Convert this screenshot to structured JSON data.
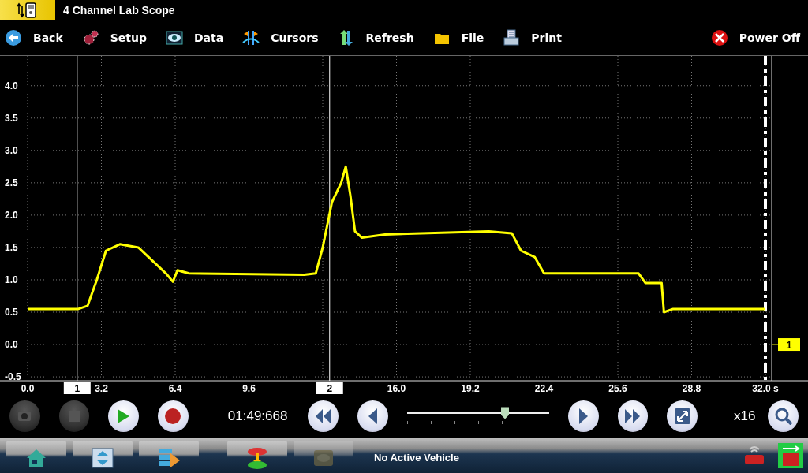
{
  "title_bar": {
    "title": "4 Channel Lab Scope"
  },
  "toolbar": {
    "items": [
      {
        "kind": "back",
        "label": "Back"
      },
      {
        "kind": "setup",
        "label": "Setup"
      },
      {
        "kind": "data",
        "label": "Data"
      },
      {
        "kind": "cursors",
        "label": "Cursors"
      },
      {
        "kind": "refresh",
        "label": "Refresh"
      },
      {
        "kind": "file",
        "label": "File"
      },
      {
        "kind": "print",
        "label": "Print"
      }
    ],
    "power_off": {
      "label": "Power Off"
    }
  },
  "scope": {
    "chart_data": {
      "type": "line",
      "x": [
        0,
        2.2,
        2.6,
        3.0,
        3.4,
        4.0,
        4.8,
        5.4,
        6.0,
        6.3,
        6.5,
        7.0,
        12.0,
        12.5,
        12.8,
        13.2,
        13.6,
        13.8,
        14.0,
        14.2,
        14.5,
        15.5,
        20.0,
        21.0,
        21.4,
        22.0,
        22.4,
        26.5,
        26.8,
        27.5,
        27.6,
        28.0,
        32.0
      ],
      "series": [
        {
          "name": "1",
          "color": "#ffff00",
          "values": [
            0.55,
            0.55,
            0.6,
            1.0,
            1.45,
            1.55,
            1.5,
            1.3,
            1.1,
            0.97,
            1.15,
            1.1,
            1.08,
            1.1,
            1.5,
            2.2,
            2.5,
            2.75,
            2.3,
            1.75,
            1.65,
            1.7,
            1.75,
            1.72,
            1.45,
            1.35,
            1.1,
            1.1,
            0.95,
            0.95,
            0.5,
            0.55,
            0.55
          ]
        }
      ],
      "xlim": [
        0,
        32
      ],
      "ylim": [
        -0.56,
        4.46
      ],
      "grid": true,
      "xticks": [
        {
          "value": 0,
          "label": "0.0"
        },
        {
          "value": 3.2,
          "label": "3.2"
        },
        {
          "value": 6.4,
          "label": "6.4"
        },
        {
          "value": 9.6,
          "label": "9.6"
        },
        {
          "value": 16,
          "label": "16.0"
        },
        {
          "value": 19.2,
          "label": "19.2"
        },
        {
          "value": 22.4,
          "label": "22.4"
        },
        {
          "value": 25.6,
          "label": "25.6"
        },
        {
          "value": 28.8,
          "label": "28.8"
        },
        {
          "value": 32,
          "label": "32.0 s"
        }
      ],
      "yticks": [
        {
          "value": -0.5,
          "label": "-0.5"
        },
        {
          "value": 0,
          "label": "0.0"
        },
        {
          "value": 0.5,
          "label": "0.5"
        },
        {
          "value": 1,
          "label": "1.0"
        },
        {
          "value": 1.5,
          "label": "1.5"
        },
        {
          "value": 2,
          "label": "2.0"
        },
        {
          "value": 2.5,
          "label": "2.5"
        },
        {
          "value": 3,
          "label": "3.0"
        },
        {
          "value": 3.5,
          "label": "3.5"
        },
        {
          "value": 4,
          "label": "4.0"
        }
      ],
      "ref_lines": [
        {
          "axis": "x",
          "value": 2.15
        },
        {
          "axis": "x",
          "value": 13.1
        }
      ]
    },
    "cursors": [
      {
        "label": "1"
      },
      {
        "label": "2"
      }
    ]
  },
  "controls": [
    {
      "kind": "camera",
      "disabled": true
    },
    {
      "kind": "stop",
      "disabled": true
    },
    {
      "kind": "play",
      "disabled": false
    },
    {
      "kind": "record",
      "disabled": false
    },
    {
      "kind": "time",
      "text": "01:49:668"
    },
    {
      "kind": "rewind",
      "disabled": false
    },
    {
      "kind": "step-back",
      "disabled": false
    },
    {
      "kind": "slider",
      "level": 0.69
    },
    {
      "kind": "step-forward",
      "disabled": false
    },
    {
      "kind": "fast-forward",
      "disabled": false
    },
    {
      "kind": "fit",
      "disabled": false
    },
    {
      "kind": "zoom-text",
      "text": "x16"
    },
    {
      "kind": "search",
      "disabled": false
    }
  ],
  "taskbar": {
    "buttons": [
      {
        "kind": "home",
        "disabled": false
      },
      {
        "kind": "windows",
        "disabled": false
      },
      {
        "kind": "transfer",
        "disabled": false
      },
      {
        "kind": "vehicles",
        "disabled": false
      },
      {
        "kind": "vehicle",
        "disabled": true
      }
    ],
    "status": "No Active Vehicle",
    "tray": [
      {
        "kind": "wireless"
      },
      {
        "kind": "usb"
      }
    ]
  }
}
